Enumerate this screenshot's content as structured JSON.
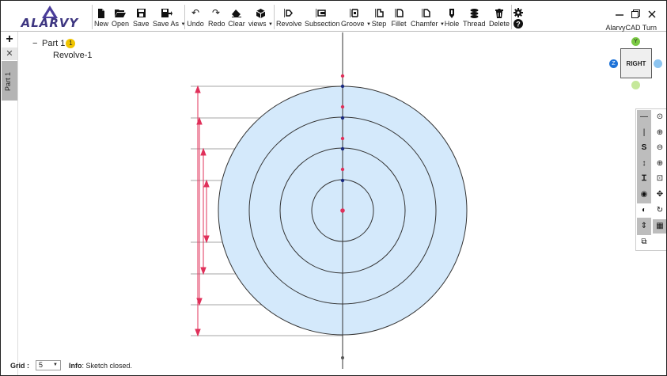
{
  "app": {
    "logo_text": "ALARVY",
    "title": "AlarvyCAD Turn"
  },
  "toolbar": {
    "file": [
      {
        "label": "New",
        "icon": "file-icon"
      },
      {
        "label": "Open",
        "icon": "folder-open-icon"
      },
      {
        "label": "Save",
        "icon": "floppy-icon"
      },
      {
        "label": "Save As",
        "icon": "save-as-icon"
      }
    ],
    "edit": [
      {
        "label": "Undo",
        "icon": "undo-icon"
      },
      {
        "label": "Redo",
        "icon": "redo-icon"
      },
      {
        "label": "Clear",
        "icon": "eraser-icon"
      },
      {
        "label": "views",
        "icon": "cube-icon"
      }
    ],
    "features": [
      {
        "label": "Revolve",
        "icon": "revolve-icon"
      },
      {
        "label": "Subsection",
        "icon": "subsection-icon"
      },
      {
        "label": "Groove",
        "icon": "groove-icon"
      },
      {
        "label": "Step",
        "icon": "step-icon"
      },
      {
        "label": "Fillet",
        "icon": "fillet-icon"
      },
      {
        "label": "Chamfer",
        "icon": "chamfer-icon"
      },
      {
        "label": "Hole",
        "icon": "hole-icon"
      },
      {
        "label": "Thread",
        "icon": "thread-icon"
      },
      {
        "label": "Delete",
        "icon": "trash-icon"
      }
    ]
  },
  "sidebar": {
    "add_label": "+",
    "close_label": "✕",
    "tab_label": "Part 1"
  },
  "tree": {
    "collapse": "−",
    "part_label": "Part 1",
    "part_badge": "1",
    "child_label": "Revolve-1"
  },
  "viewcube": {
    "face_label": "RIGHT",
    "y_label": "Y",
    "z_label": "Z",
    "colors": {
      "y": "#7ac943",
      "z": "#1e73d8",
      "x": "#8cc4f0",
      "face": "#efefef"
    }
  },
  "panel": {
    "left": [
      {
        "icon": "horizontal-line-icon",
        "glyph": "—"
      },
      {
        "icon": "vertical-line-icon",
        "glyph": "|"
      },
      {
        "icon": "spline-icon",
        "glyph": "S"
      },
      {
        "icon": "vertical-dimension-icon",
        "glyph": "↕"
      },
      {
        "icon": "i-beam-icon",
        "glyph": "Ɪ"
      },
      {
        "icon": "eye-icon",
        "glyph": "◉"
      },
      {
        "icon": "contrast-icon",
        "glyph": "◐"
      },
      {
        "icon": "up-down-arrows-icon",
        "glyph": "⇕"
      },
      {
        "icon": "layers-icon",
        "glyph": "⧉"
      }
    ],
    "right": [
      {
        "icon": "mouse-icon",
        "glyph": "⊙"
      },
      {
        "icon": "zoom-in-icon",
        "glyph": "⊕"
      },
      {
        "icon": "zoom-out-icon",
        "glyph": "⊖"
      },
      {
        "icon": "zoom-fit-icon",
        "glyph": "⊕"
      },
      {
        "icon": "zoom-window-icon",
        "glyph": "⊡"
      },
      {
        "icon": "pan-icon",
        "glyph": "✥"
      },
      {
        "icon": "rotate-icon",
        "glyph": "↻"
      },
      {
        "icon": "grid-icon",
        "glyph": "▦"
      }
    ]
  },
  "footer": {
    "grid_label": "Grid :",
    "grid_value": "5",
    "info_label": "Info",
    "info_text": ": Sketch closed."
  },
  "colors": {
    "fill": "#d4e9fb",
    "dimension": "#e0305a",
    "outline": "#333333",
    "badge": "#f0c400"
  }
}
